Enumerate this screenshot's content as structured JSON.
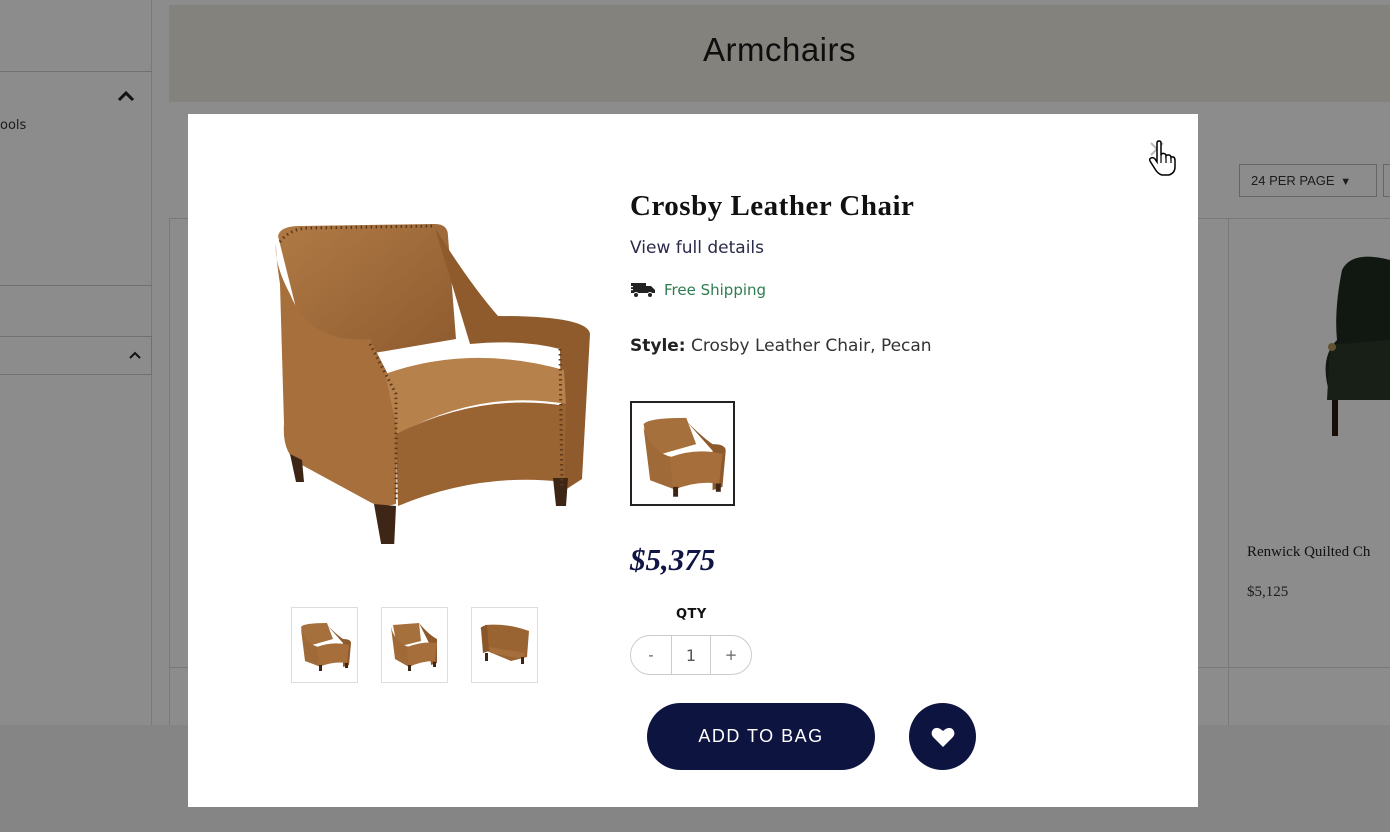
{
  "background": {
    "category_title": "Armchairs",
    "sidebar_partial_text": "ools",
    "per_page_label": "24 PER PAGE",
    "neighbor_product": {
      "name": "Renwick Quilted Ch",
      "price": "$5,125"
    }
  },
  "modal": {
    "close_icon": "close-icon",
    "product_title": "Crosby Leather Chair",
    "view_details_link": "View full details",
    "shipping": {
      "icon": "truck-icon",
      "text": "Free Shipping",
      "color": "#2e7d4f"
    },
    "style": {
      "label": "Style:",
      "value": "Crosby Leather Chair, Pecan"
    },
    "price": "$5,375",
    "quantity": {
      "label": "QTY",
      "decrement": "-",
      "value": "1",
      "increment": "+"
    },
    "add_to_bag_label": "ADD TO BAG",
    "wishlist_icon": "heart-icon",
    "accent_color": "#0e1440"
  }
}
